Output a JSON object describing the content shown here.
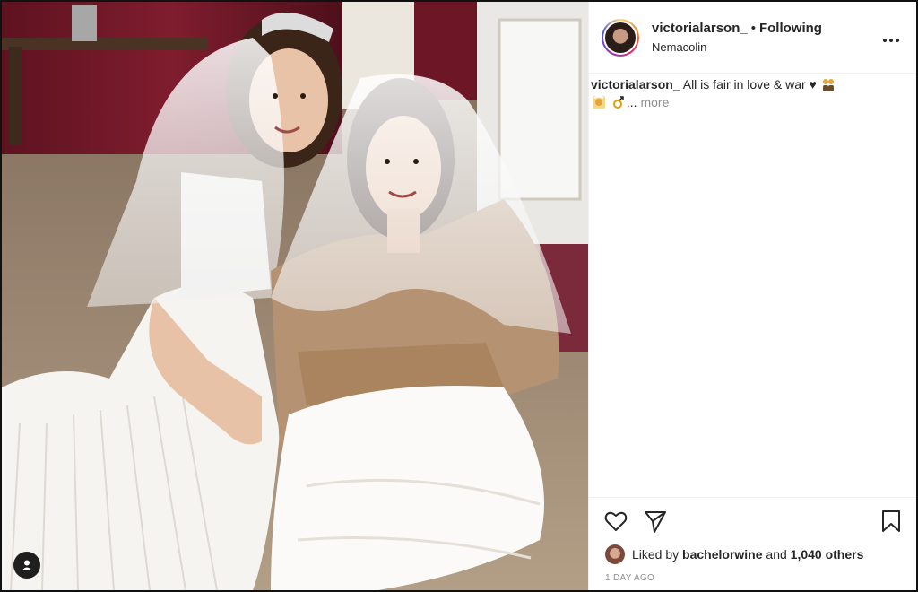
{
  "post": {
    "username": "victorialarson_",
    "separator": "•",
    "follow_state": "Following",
    "location": "Nemacolin",
    "options_icon": "more-horizontal-icon",
    "photo_description_icon": "user-tag-icon"
  },
  "caption": {
    "username": "victorialarson_",
    "text": "All is fair in love & war ♥",
    "truncation": "...",
    "more_label": "more",
    "emoji_icons": [
      "couple-icon",
      "bride-icon",
      "ring-icon"
    ]
  },
  "actions": {
    "like_icon": "heart-icon",
    "share_icon": "paper-plane-icon",
    "save_icon": "bookmark-icon"
  },
  "likes": {
    "prefix": "Liked by",
    "user": "bachelorwine",
    "joiner": "and",
    "others": "1,040 others"
  },
  "timestamp": "1 DAY AGO",
  "colors": {
    "text": "#262626",
    "muted": "#8e8e8e",
    "divider": "#efefef"
  }
}
